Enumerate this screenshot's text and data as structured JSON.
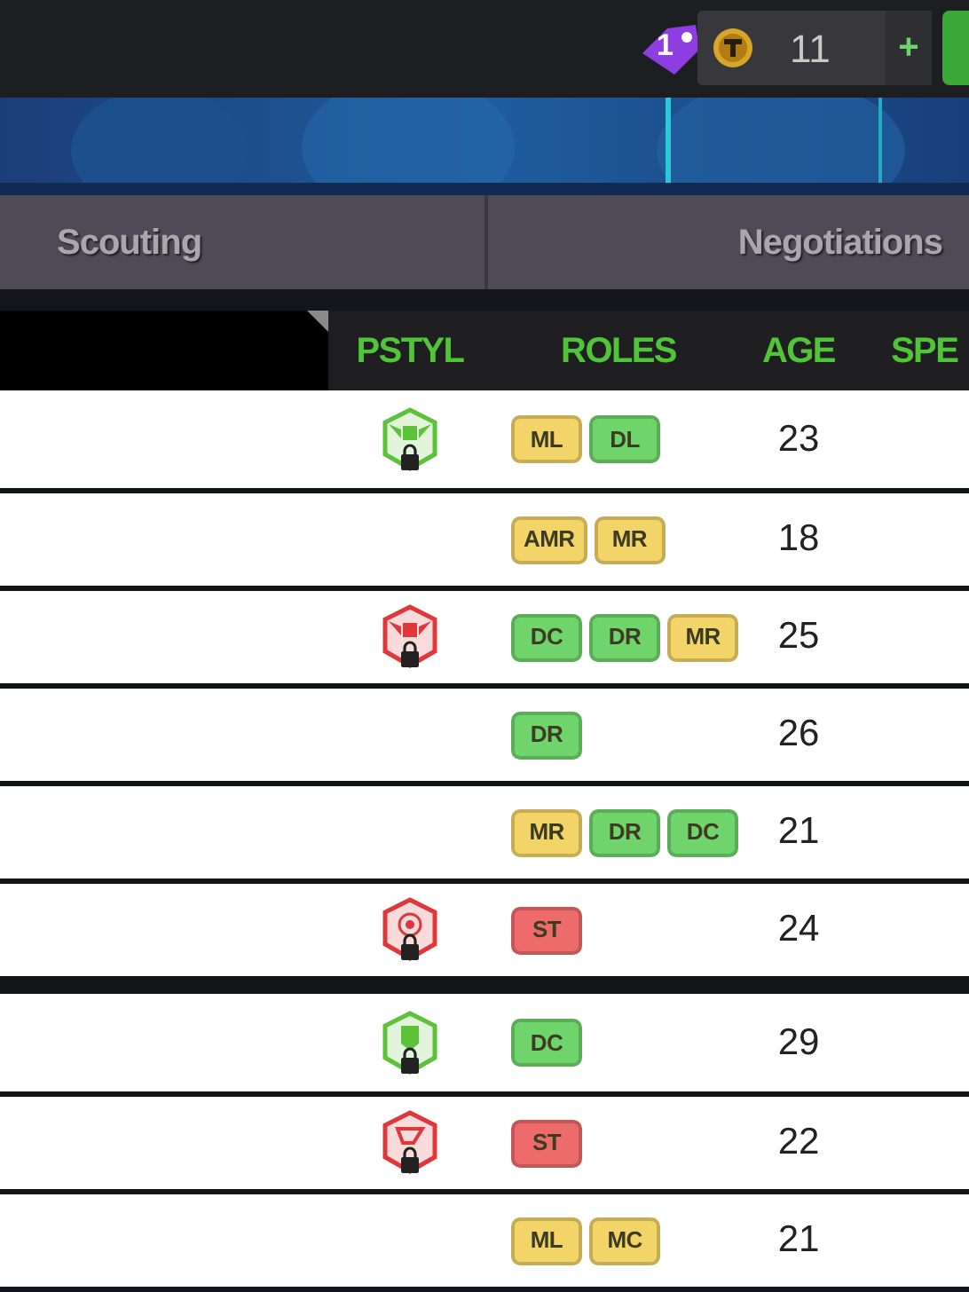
{
  "top_bar": {
    "notification_count": "1",
    "coins": "11",
    "add_label": "+"
  },
  "tabs": [
    {
      "label": "Scouting",
      "selected": false
    },
    {
      "label": "Negotiations",
      "selected": false
    }
  ],
  "table": {
    "columns": [
      "PSTYL",
      "ROLES",
      "AGE",
      "SPE"
    ],
    "groups": [
      {
        "rows": [
          {
            "pstyl": {
              "kind": "wings",
              "color": "#5cc23a",
              "locked": true
            },
            "roles": [
              {
                "label": "ML",
                "color": "#f2d468"
              },
              {
                "label": "DL",
                "color": "#6fd46b"
              }
            ],
            "age": "23"
          },
          {
            "roles": [
              {
                "label": "AMR",
                "color": "#f2d468"
              },
              {
                "label": "MR",
                "color": "#f2d468"
              }
            ],
            "age": "18"
          },
          {
            "pstyl": {
              "kind": "wings",
              "color": "#e0383a",
              "locked": true
            },
            "roles": [
              {
                "label": "DC",
                "color": "#6fd46b"
              },
              {
                "label": "DR",
                "color": "#6fd46b"
              },
              {
                "label": "MR",
                "color": "#f2d468"
              }
            ],
            "age": "25"
          },
          {
            "roles": [
              {
                "label": "DR",
                "color": "#6fd46b"
              }
            ],
            "age": "26"
          },
          {
            "roles": [
              {
                "label": "MR",
                "color": "#f2d468"
              },
              {
                "label": "DR",
                "color": "#6fd46b"
              },
              {
                "label": "DC",
                "color": "#6fd46b"
              }
            ],
            "age": "21"
          },
          {
            "pstyl": {
              "kind": "target",
              "color": "#e0383a",
              "locked": true
            },
            "roles": [
              {
                "label": "ST",
                "color": "#ee6b6b"
              }
            ],
            "age": "24"
          }
        ]
      },
      {
        "rows": [
          {
            "pstyl": {
              "kind": "shield",
              "color": "#5cc23a",
              "locked": true
            },
            "roles": [
              {
                "label": "DC",
                "color": "#6fd46b"
              }
            ],
            "age": "29"
          },
          {
            "pstyl": {
              "kind": "whistle",
              "color": "#e0383a",
              "locked": true
            },
            "roles": [
              {
                "label": "ST",
                "color": "#ee6b6b"
              }
            ],
            "age": "22"
          },
          {
            "roles": [
              {
                "label": "ML",
                "color": "#f2d468"
              },
              {
                "label": "MC",
                "color": "#f2d468"
              }
            ],
            "age": "21"
          }
        ]
      }
    ]
  }
}
